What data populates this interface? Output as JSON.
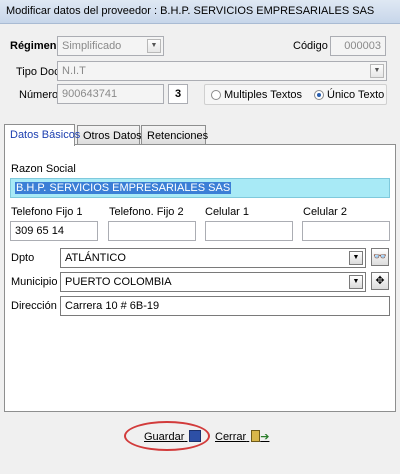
{
  "window": {
    "title": "Modificar datos del proveedor : B.H.P. SERVICIOS EMPRESARIALES SAS"
  },
  "header": {
    "regimen_label": "Régimen",
    "regimen_value": "Simplificado",
    "codigo_label": "Código",
    "codigo_value": "000003",
    "tipo_doc_label": "Tipo Doc",
    "tipo_doc_value": "N.I.T",
    "numero_label": "Número",
    "numero_value": "900643741",
    "dv_value": "3",
    "radio_multiples": "Multiples Textos",
    "radio_unico": "Único Texto",
    "selected_radio": "Único Texto"
  },
  "tabs": [
    {
      "label": "Datos Básicos",
      "active": true
    },
    {
      "label": "Otros Datos",
      "active": false
    },
    {
      "label": "Retenciones",
      "active": false
    }
  ],
  "basic": {
    "razon_social_label": "Razon Social",
    "razon_social_value": "B.H.P. SERVICIOS EMPRESARIALES SAS",
    "tel1_label": "Telefono Fijo 1",
    "tel1_value": "309 65 14",
    "tel2_label": "Telefono. Fijo 2",
    "tel2_value": "",
    "cel1_label": "Celular 1",
    "cel1_value": "",
    "cel2_label": "Celular 2",
    "cel2_value": "",
    "dpto_label": "Dpto",
    "dpto_value": "ATLÁNTICO",
    "municipio_label": "Municipio",
    "municipio_value": "PUERTO COLOMBIA",
    "direccion_label": "Dirección",
    "direccion_value": "Carrera 10 # 6B-19"
  },
  "actions": {
    "guardar": "Guardar",
    "cerrar": "Cerrar"
  },
  "colors": {
    "highlight": "#a8eaf6",
    "selection": "#3b7fd6",
    "annotation": "#d23b3b"
  },
  "icons": [
    "dropdown-arrow-icon",
    "binoculars-icon",
    "plus-icon",
    "floppy-disk-icon",
    "exit-door-icon"
  ]
}
